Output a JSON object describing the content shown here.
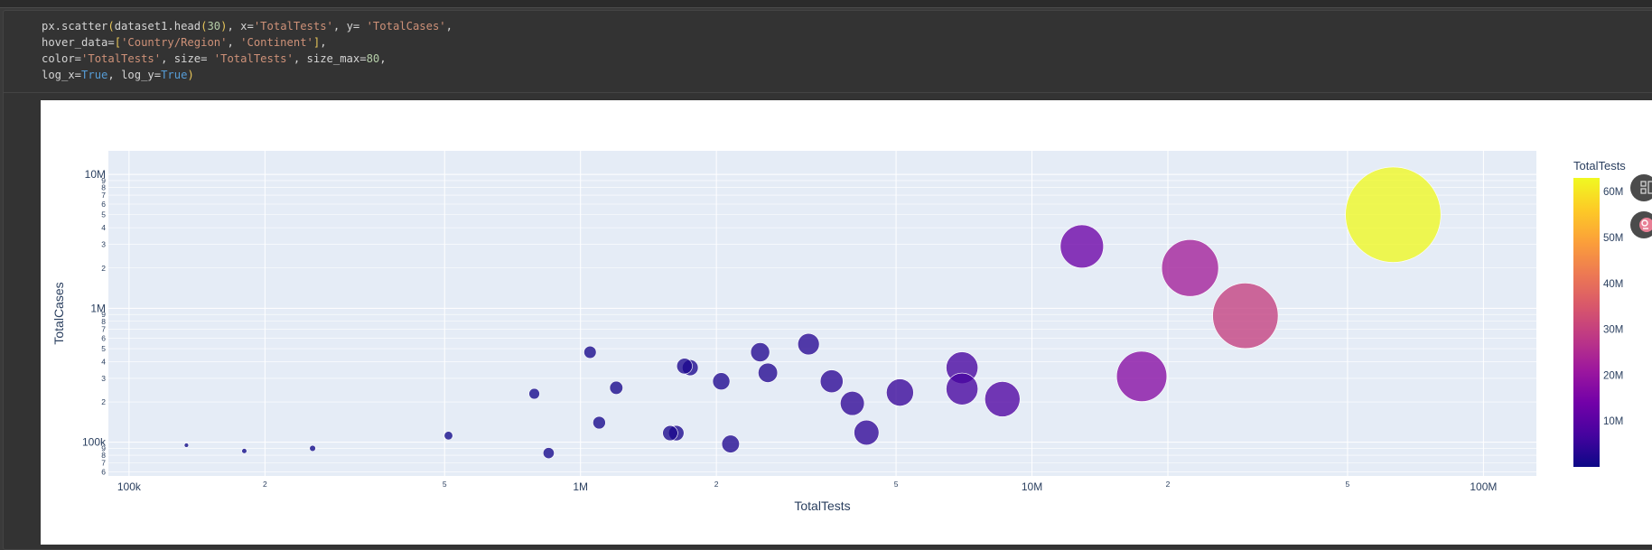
{
  "code": {
    "lines": [
      [
        [
          "px.scatter",
          "fn"
        ],
        [
          "(",
          "p"
        ],
        [
          "dataset1.head",
          "fn"
        ],
        [
          "(",
          "p"
        ],
        [
          "30",
          "n"
        ],
        [
          ")",
          "p"
        ],
        [
          ", x=",
          "fn"
        ],
        [
          "'TotalTests'",
          "s"
        ],
        [
          ", y= ",
          "fn"
        ],
        [
          "'TotalCases'",
          "s"
        ],
        [
          ",",
          "fn"
        ]
      ],
      [
        [
          "hover_data=",
          "fn"
        ],
        [
          "[",
          "p"
        ],
        [
          "'Country/Region'",
          "s"
        ],
        [
          ", ",
          "fn"
        ],
        [
          "'Continent'",
          "s"
        ],
        [
          "]",
          "p"
        ],
        [
          ",",
          "fn"
        ]
      ],
      [
        [
          "color=",
          "fn"
        ],
        [
          "'TotalTests'",
          "s"
        ],
        [
          ", size= ",
          "fn"
        ],
        [
          "'TotalTests'",
          "s"
        ],
        [
          ", size_max=",
          "fn"
        ],
        [
          "80",
          "n"
        ],
        [
          ",",
          "fn"
        ]
      ],
      [
        [
          "log_x=",
          "fn"
        ],
        [
          "True",
          "k"
        ],
        [
          ", log_y=",
          "fn"
        ],
        [
          "True",
          "k"
        ],
        [
          ")",
          "p"
        ]
      ]
    ]
  },
  "chart_data": {
    "type": "scatter",
    "xlabel": "TotalTests",
    "ylabel": "TotalCases",
    "x_scale": "log",
    "y_scale": "log",
    "xlim": [
      90000,
      131000000
    ],
    "ylim": [
      56000,
      15000000
    ],
    "x_tick_labels": [
      {
        "value": 100000,
        "label": "100k"
      },
      {
        "value": 200000,
        "label": "2"
      },
      {
        "value": 500000,
        "label": "5"
      },
      {
        "value": 1000000,
        "label": "1M"
      },
      {
        "value": 2000000,
        "label": "2"
      },
      {
        "value": 5000000,
        "label": "5"
      },
      {
        "value": 10000000,
        "label": "10M"
      },
      {
        "value": 20000000,
        "label": "2"
      },
      {
        "value": 50000000,
        "label": "5"
      },
      {
        "value": 100000000,
        "label": "100M"
      }
    ],
    "y_tick_labels": [
      {
        "value": 60000,
        "label": "6"
      },
      {
        "value": 70000,
        "label": "7"
      },
      {
        "value": 80000,
        "label": "8"
      },
      {
        "value": 90000,
        "label": "9"
      },
      {
        "value": 100000,
        "label": "100k"
      },
      {
        "value": 200000,
        "label": "2"
      },
      {
        "value": 300000,
        "label": "3"
      },
      {
        "value": 400000,
        "label": "4"
      },
      {
        "value": 500000,
        "label": "5"
      },
      {
        "value": 600000,
        "label": "6"
      },
      {
        "value": 700000,
        "label": "7"
      },
      {
        "value": 800000,
        "label": "8"
      },
      {
        "value": 900000,
        "label": "9"
      },
      {
        "value": 1000000,
        "label": "1M"
      },
      {
        "value": 2000000,
        "label": "2"
      },
      {
        "value": 3000000,
        "label": "3"
      },
      {
        "value": 4000000,
        "label": "4"
      },
      {
        "value": 5000000,
        "label": "5"
      },
      {
        "value": 6000000,
        "label": "6"
      },
      {
        "value": 7000000,
        "label": "7"
      },
      {
        "value": 8000000,
        "label": "8"
      },
      {
        "value": 9000000,
        "label": "9"
      },
      {
        "value": 10000000,
        "label": "10M"
      }
    ],
    "grid": true,
    "legend": "none",
    "colorbar": {
      "title": "TotalTests",
      "range": [
        0,
        63000000
      ],
      "tick_labels": [
        {
          "value": 10000000,
          "label": "10M"
        },
        {
          "value": 20000000,
          "label": "20M"
        },
        {
          "value": 30000000,
          "label": "30M"
        },
        {
          "value": 40000000,
          "label": "40M"
        },
        {
          "value": 50000000,
          "label": "50M"
        },
        {
          "value": 60000000,
          "label": "60M"
        }
      ],
      "colors": [
        "#0d0887",
        "#46039f",
        "#7201a8",
        "#9c179e",
        "#bd3786",
        "#d8576b",
        "#ed7953",
        "#fb9f3a",
        "#fdca26",
        "#f0f921"
      ]
    },
    "points": [
      {
        "x": 63100000,
        "y": 5000000
      },
      {
        "x": 29700000,
        "y": 880000
      },
      {
        "x": 22400000,
        "y": 2000000
      },
      {
        "x": 17500000,
        "y": 310000
      },
      {
        "x": 12900000,
        "y": 2900000
      },
      {
        "x": 8600000,
        "y": 210000
      },
      {
        "x": 7000000,
        "y": 360000
      },
      {
        "x": 7000000,
        "y": 250000
      },
      {
        "x": 5100000,
        "y": 235000
      },
      {
        "x": 4300000,
        "y": 118000
      },
      {
        "x": 4000000,
        "y": 195000
      },
      {
        "x": 3600000,
        "y": 285000
      },
      {
        "x": 3200000,
        "y": 540000
      },
      {
        "x": 2600000,
        "y": 330000
      },
      {
        "x": 2500000,
        "y": 470000
      },
      {
        "x": 2150000,
        "y": 97000
      },
      {
        "x": 2050000,
        "y": 285000
      },
      {
        "x": 1750000,
        "y": 360000
      },
      {
        "x": 1700000,
        "y": 370000
      },
      {
        "x": 1630000,
        "y": 117000
      },
      {
        "x": 1580000,
        "y": 117000
      },
      {
        "x": 1200000,
        "y": 255000
      },
      {
        "x": 1100000,
        "y": 140000
      },
      {
        "x": 1050000,
        "y": 470000
      },
      {
        "x": 850000,
        "y": 83000
      },
      {
        "x": 790000,
        "y": 230000
      },
      {
        "x": 510000,
        "y": 112000
      },
      {
        "x": 255000,
        "y": 90000
      },
      {
        "x": 180000,
        "y": 86000
      },
      {
        "x": 134000,
        "y": 95000
      }
    ]
  }
}
